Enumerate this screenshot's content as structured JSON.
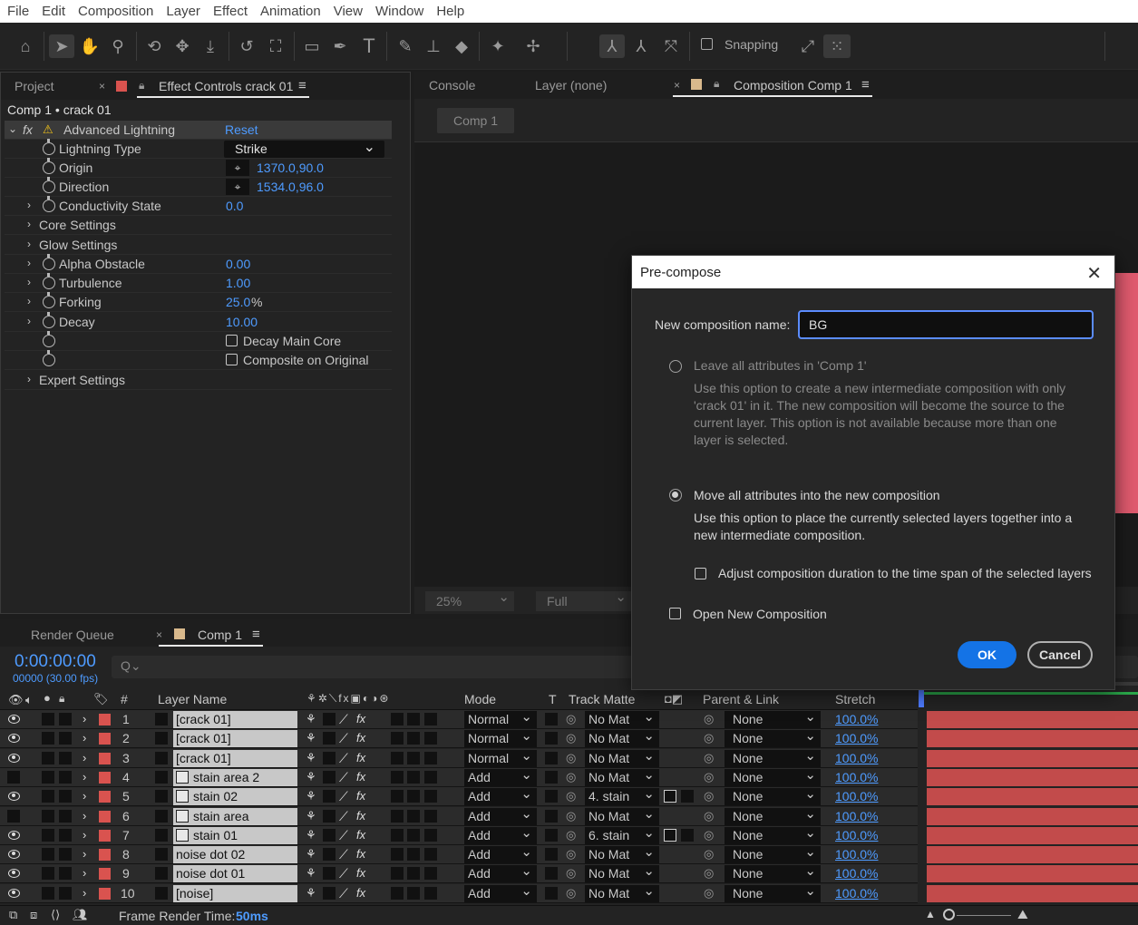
{
  "menu": [
    "File",
    "Edit",
    "Composition",
    "Layer",
    "Effect",
    "Animation",
    "View",
    "Window",
    "Help"
  ],
  "toolbar": {
    "snapping_label": "Snapping",
    "icons": [
      "home-icon",
      "selection-tool-icon",
      "hand-tool-icon",
      "zoom-tool-icon",
      "orbit-camera-icon",
      "pan-camera-icon",
      "dolly-camera-icon",
      "rotation-tool-icon",
      "pan-behind-icon",
      "rectangle-tool-icon",
      "pen-tool-icon",
      "type-tool-icon",
      "brush-tool-icon",
      "clone-stamp-icon",
      "eraser-icon",
      "roto-brush-icon",
      "puppet-pin-icon",
      "local-axis-icon",
      "world-axis-icon",
      "view-axis-icon",
      "snapping-checkbox"
    ]
  },
  "left_panel": {
    "tab_project": "Project",
    "tab_effect_controls": "Effect Controls crack 01",
    "breadcrumb": "Comp 1 • crack 01",
    "effect_name": "Advanced Lightning",
    "reset_label": "Reset",
    "props": [
      {
        "name": "Lightning Type",
        "value": "Strike"
      },
      {
        "name": "Origin",
        "value": "1370.0,90.0"
      },
      {
        "name": "Direction",
        "value": "1534.0,96.0"
      },
      {
        "name": "Conductivity State",
        "value": "0.0"
      },
      {
        "name": "Core Settings",
        "value": ""
      },
      {
        "name": "Glow Settings",
        "value": ""
      },
      {
        "name": "Alpha Obstacle",
        "value": "0.00"
      },
      {
        "name": "Turbulence",
        "value": "1.00"
      },
      {
        "name": "Forking",
        "value": "25.0",
        "unit": "%"
      },
      {
        "name": "Decay",
        "value": "10.00"
      },
      {
        "name": "",
        "value": "Decay Main Core"
      },
      {
        "name": "",
        "value": "Composite on Original"
      },
      {
        "name": "Expert Settings",
        "value": ""
      }
    ]
  },
  "viewer": {
    "tab_console": "Console",
    "tab_layer": "Layer (none)",
    "tab_comp": "Composition Comp 1",
    "comp_button": "Comp 1",
    "zoom": "25%",
    "resolution": "Full"
  },
  "dialog": {
    "title": "Pre-compose",
    "name_label": "New composition name:",
    "name_value": "BG",
    "opt1_label": "Leave all attributes in 'Comp 1'",
    "opt1_desc": "Use this option to create a new intermediate composition with only 'crack 01' in it. The new composition will become the source to the current layer. This option is not available because more than one layer is selected.",
    "opt2_label": "Move all attributes into the new composition",
    "opt2_desc": "Use this option to place the currently selected layers together into a new intermediate composition.",
    "adjust_label": "Adjust composition duration to the time span of the selected layers",
    "open_label": "Open New Composition",
    "ok": "OK",
    "cancel": "Cancel"
  },
  "timeline": {
    "tab_render": "Render Queue",
    "tab_comp": "Comp 1",
    "timecode": "0:00:00:00",
    "frames": "00000 (30.00 fps)",
    "search_placeholder": "Q⌄",
    "headers": {
      "num": "#",
      "layer_name": "Layer Name",
      "mode": "Mode",
      "t": "T",
      "track_matte": "Track Matte",
      "parent": "Parent & Link",
      "stretch": "Stretch"
    },
    "layers": [
      {
        "num": "1",
        "name": "[crack 01]",
        "mode": "Normal",
        "matte": "No Mat",
        "parent": "None",
        "stretch": "100.0%",
        "visible": true,
        "source": false
      },
      {
        "num": "2",
        "name": "[crack 01]",
        "mode": "Normal",
        "matte": "No Mat",
        "parent": "None",
        "stretch": "100.0%",
        "visible": true,
        "source": false
      },
      {
        "num": "3",
        "name": "[crack 01]",
        "mode": "Normal",
        "matte": "No Mat",
        "parent": "None",
        "stretch": "100.0%",
        "visible": true,
        "source": false
      },
      {
        "num": "4",
        "name": "stain area 2",
        "mode": "Add",
        "matte": "No Mat",
        "parent": "None",
        "stretch": "100.0%",
        "visible": false,
        "source": true
      },
      {
        "num": "5",
        "name": "stain 02",
        "mode": "Add",
        "matte": "4. stain",
        "parent": "None",
        "stretch": "100.0%",
        "visible": true,
        "source": true
      },
      {
        "num": "6",
        "name": "stain area",
        "mode": "Add",
        "matte": "No Mat",
        "parent": "None",
        "stretch": "100.0%",
        "visible": false,
        "source": true
      },
      {
        "num": "7",
        "name": "stain 01",
        "mode": "Add",
        "matte": "6. stain",
        "parent": "None",
        "stretch": "100.0%",
        "visible": true,
        "source": true
      },
      {
        "num": "8",
        "name": "noise dot 02",
        "mode": "Add",
        "matte": "No Mat",
        "parent": "None",
        "stretch": "100.0%",
        "visible": true,
        "source": false
      },
      {
        "num": "9",
        "name": "noise dot 01",
        "mode": "Add",
        "matte": "No Mat",
        "parent": "None",
        "stretch": "100.0%",
        "visible": true,
        "source": false
      },
      {
        "num": "10",
        "name": "[noise]",
        "mode": "Add",
        "matte": "No Mat",
        "parent": "None",
        "stretch": "100.0%",
        "visible": true,
        "source": false
      }
    ],
    "frame_render_label": "Frame Render Time:",
    "frame_render_value": "50ms"
  },
  "colors": {
    "accent": "#1473e6",
    "value_blue": "#4e9bff",
    "layer_label_red": "#d9534f",
    "bar_red": "#c24b4b"
  }
}
